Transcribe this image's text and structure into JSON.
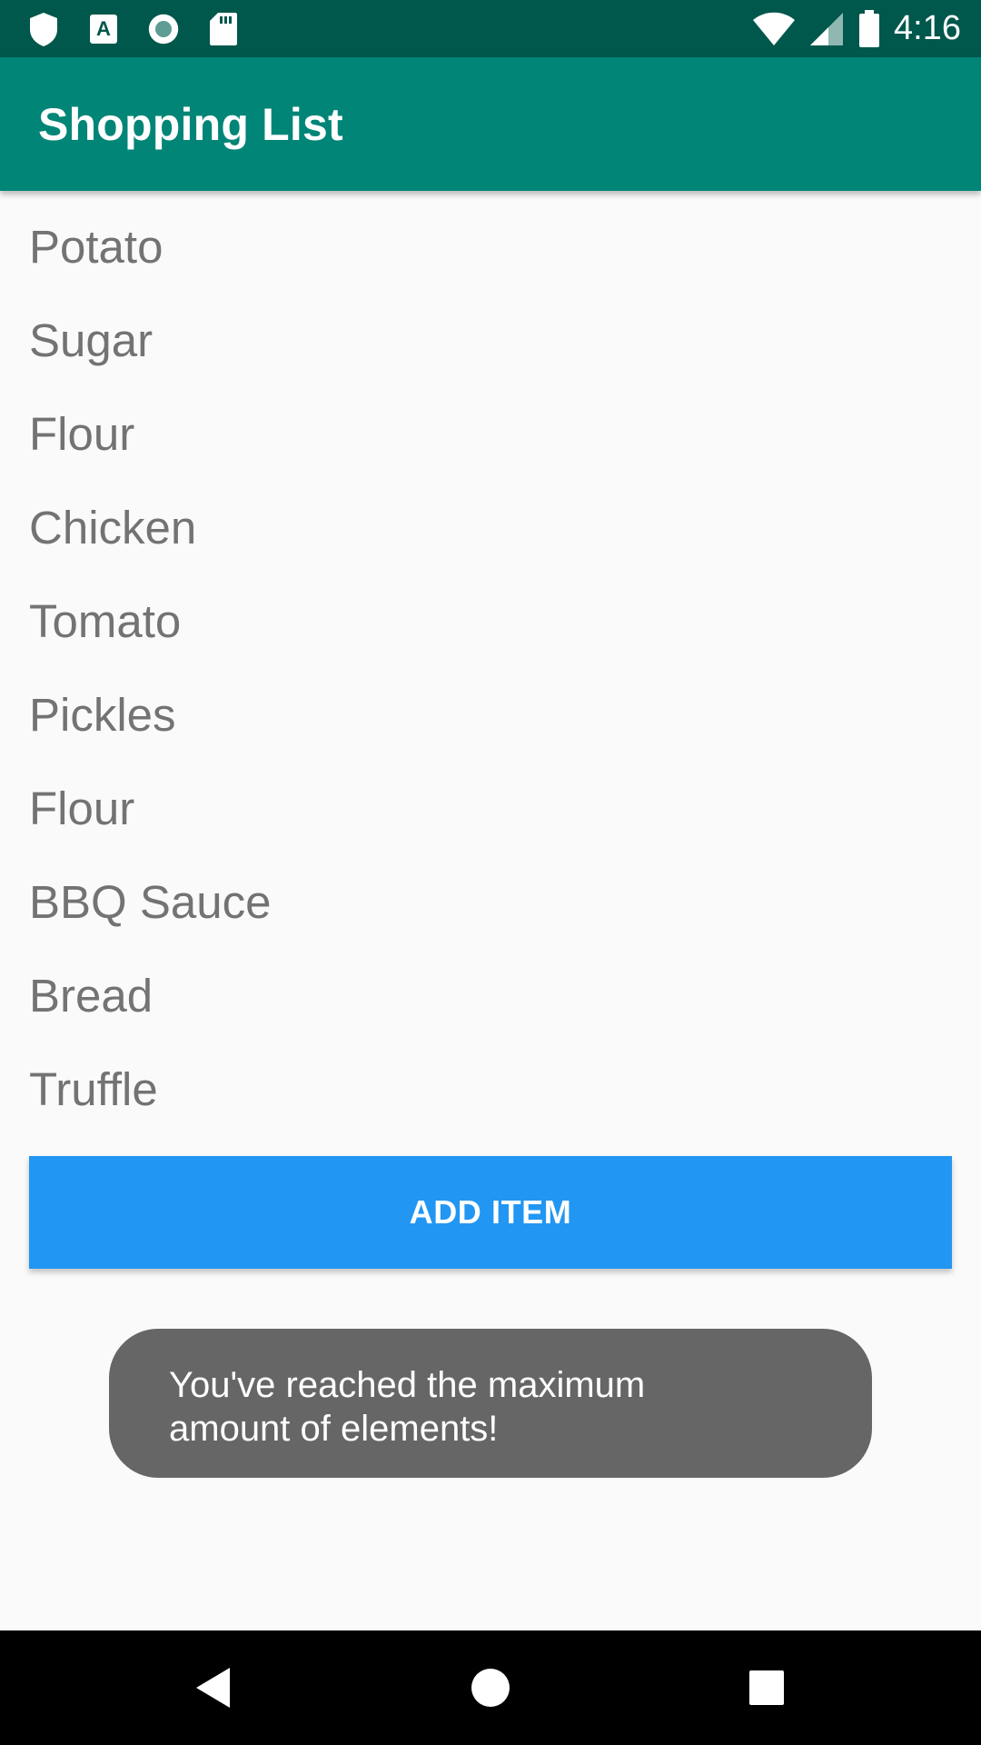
{
  "status_bar": {
    "time": "4:16",
    "left_icons": [
      "shield-icon",
      "keyboard-a-icon",
      "circle-record-icon",
      "sd-card-icon"
    ],
    "right_icons": [
      "wifi-icon",
      "signal-icon",
      "battery-icon"
    ]
  },
  "app_bar": {
    "title": "Shopping List"
  },
  "list": {
    "items": [
      "Potato",
      "Sugar",
      "Flour",
      "Chicken",
      "Tomato",
      "Pickles",
      "Flour",
      "BBQ Sauce",
      "Bread",
      "Truffle"
    ]
  },
  "add_button": {
    "label": "ADD ITEM"
  },
  "toast": {
    "message": "You've reached the maximum amount of elements!"
  },
  "nav_bar": {
    "icons": [
      "back-icon",
      "home-icon",
      "recents-icon"
    ]
  },
  "colors": {
    "status_bar": "#00574B",
    "app_bar": "#008577",
    "button": "#2196F3",
    "toast": "#666666",
    "list_text": "#737373",
    "background": "#FAFAFA"
  }
}
